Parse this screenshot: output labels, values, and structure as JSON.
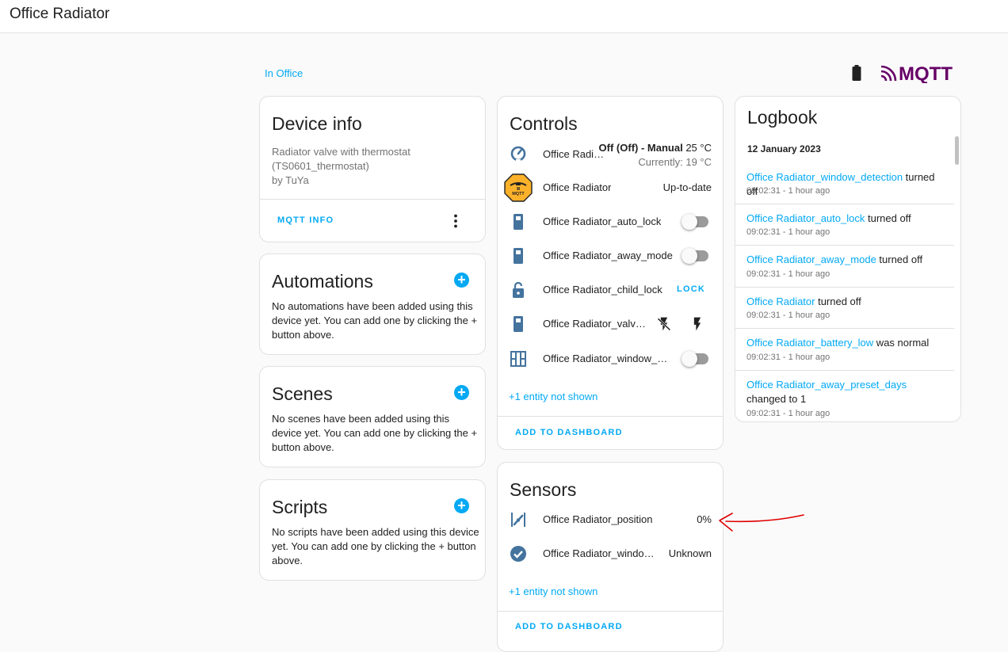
{
  "app": {
    "title": "Office Radiator"
  },
  "area": {
    "label": "In Office"
  },
  "icons": {
    "battery": "battery-icon",
    "mqtt_logo": "mqtt-logo"
  },
  "colors": {
    "accent": "#03a9f4",
    "entity_icon": "#44739e",
    "annotation": "#e00000"
  },
  "device_info": {
    "title": "Device info",
    "model": "Radiator valve with thermostat",
    "model_id": "(TS0601_thermostat)",
    "manufacturer": "by TuYa",
    "action": "MQTT INFO"
  },
  "automations": {
    "title": "Automations",
    "text": "No automations have been added using this device yet. You can add one by clicking the + button above."
  },
  "scenes": {
    "title": "Scenes",
    "text": "No scenes have been added using this device yet. You can add one by clicking the + button above."
  },
  "scripts": {
    "title": "Scripts",
    "text": "No scripts have been added using this device yet. You can add one by clicking the + button above."
  },
  "controls": {
    "title": "Controls",
    "climate": {
      "name": "Office Radi…",
      "state": "Off (Off) - Manual",
      "target": "25 °C",
      "current": "Currently: 19 °C"
    },
    "update": {
      "name": "Office Radiator",
      "state": "Up-to-date"
    },
    "auto_lock": {
      "name": "Office Radiator_auto_lock",
      "on": false
    },
    "away_mode": {
      "name": "Office Radiator_away_mode",
      "on": false
    },
    "child_lock": {
      "name": "Office Radiator_child_lock",
      "action": "LOCK"
    },
    "valve": {
      "name": "Office Radiator_valve…"
    },
    "window": {
      "name": "Office Radiator_window_de…",
      "on": false
    },
    "more": "+1 entity not shown",
    "action": "ADD TO DASHBOARD"
  },
  "sensors": {
    "title": "Sensors",
    "position": {
      "name": "Office Radiator_position",
      "state": "0%"
    },
    "window": {
      "name": "Office Radiator_window_…",
      "state": "Unknown"
    },
    "more": "+1 entity not shown",
    "action": "ADD TO DASHBOARD"
  },
  "logbook": {
    "title": "Logbook",
    "date": "12 January 2023",
    "entries": [
      {
        "entity": "Office Radiator_window_detection",
        "message": " turned off",
        "time": "09:02:31 - 1 hour ago"
      },
      {
        "entity": "Office Radiator_auto_lock",
        "message": " turned off",
        "time": "09:02:31 - 1 hour ago"
      },
      {
        "entity": "Office Radiator_away_mode",
        "message": " turned off",
        "time": "09:02:31 - 1 hour ago"
      },
      {
        "entity": "Office Radiator",
        "message": " turned off",
        "time": "09:02:31 - 1 hour ago"
      },
      {
        "entity": "Office Radiator_battery_low",
        "message": " was normal",
        "time": "09:02:31 - 1 hour ago"
      },
      {
        "entity": "Office Radiator_away_preset_days",
        "message": " changed to 1",
        "time": "09:02:31 - 1 hour ago"
      }
    ]
  }
}
